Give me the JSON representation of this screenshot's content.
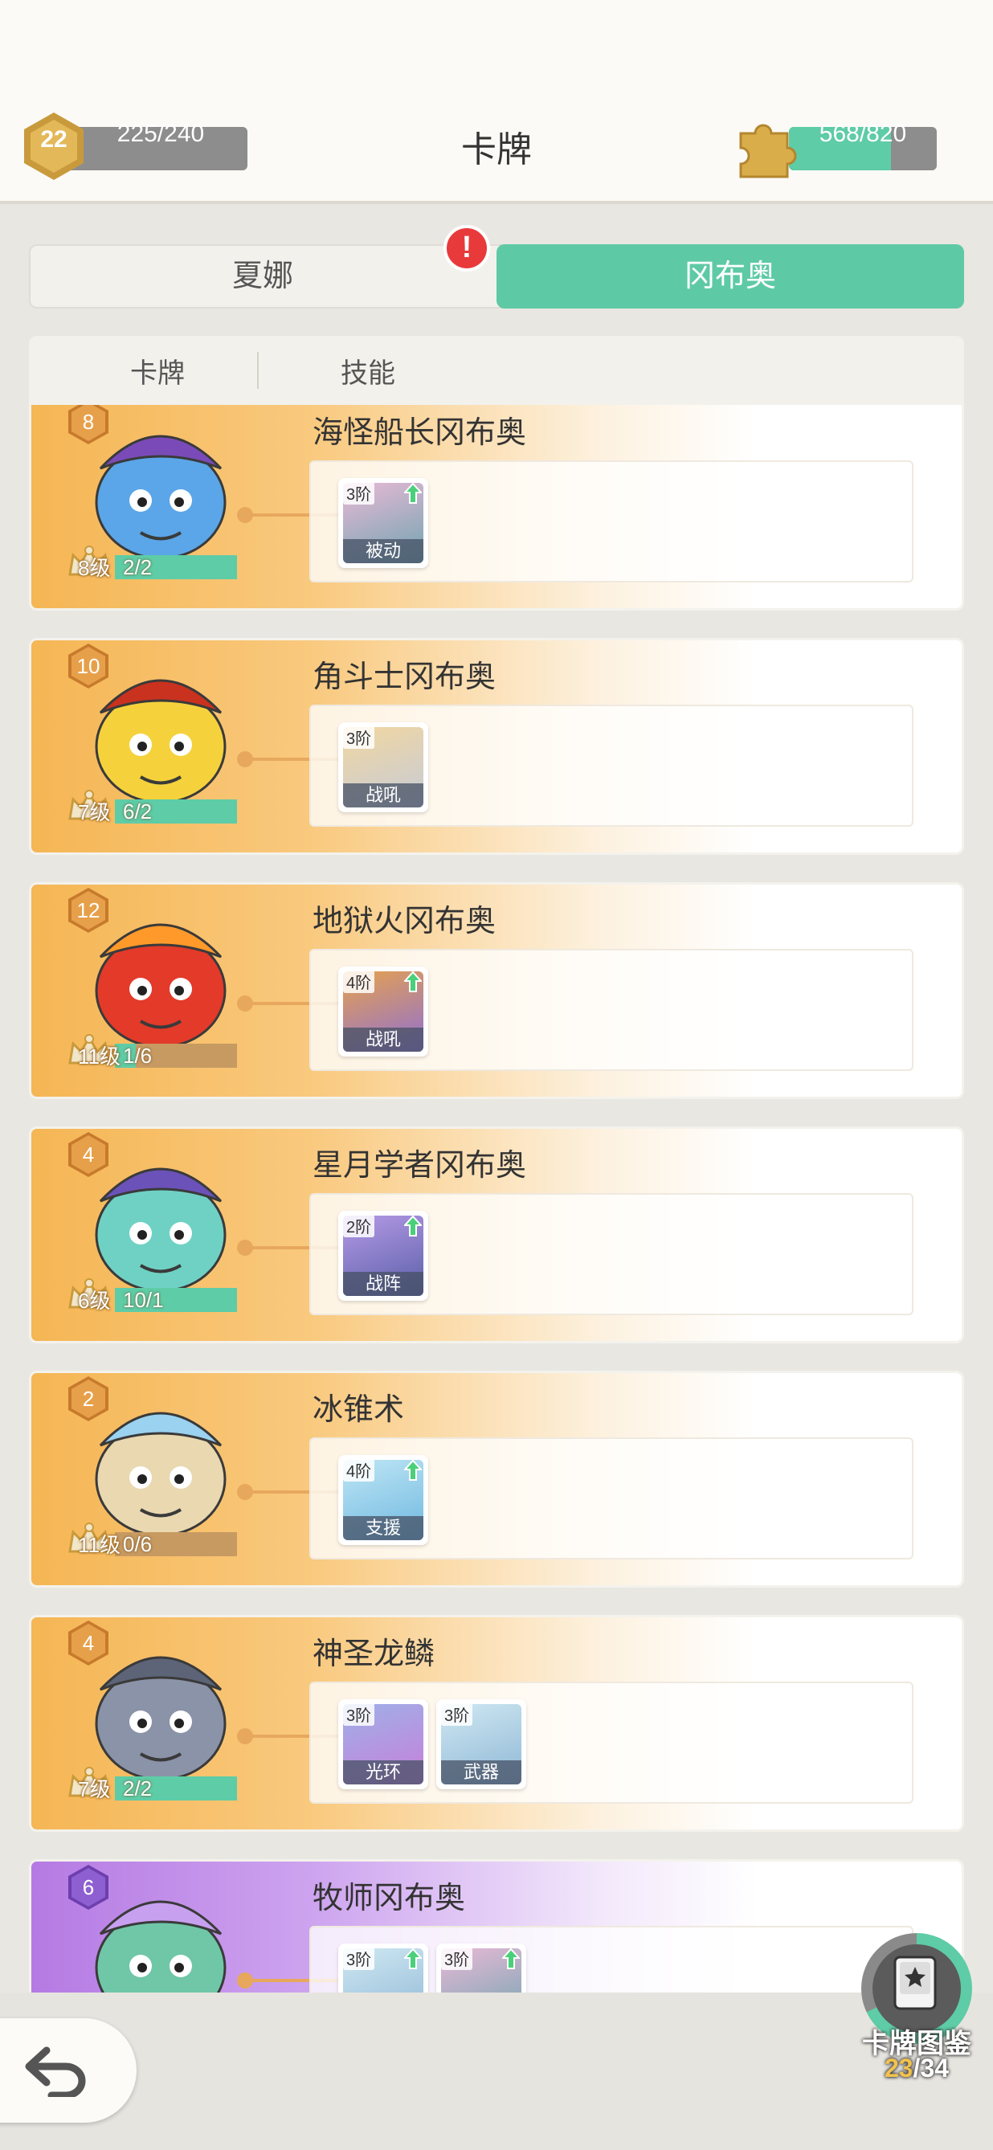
{
  "header": {
    "title": "卡牌",
    "player_level": "22",
    "exp_text": "225/240",
    "puzzle_text": "568/820",
    "puzzle_progress": 0.69
  },
  "hero_tabs": [
    {
      "label": "夏娜",
      "active": false,
      "has_alert": true
    },
    {
      "label": "冈布奥",
      "active": true,
      "has_alert": false
    }
  ],
  "alert_mark": "!",
  "sub_tabs": [
    {
      "label": "卡牌"
    },
    {
      "label": "技能"
    }
  ],
  "cards": [
    {
      "name": "海怪船长冈布奥",
      "cost": "8",
      "level_label": "8级",
      "progress_text": "2/2",
      "progress": 1.0,
      "theme": "orange",
      "skills": [
        {
          "tier": "3阶",
          "name": "被动",
          "upgradable": true
        }
      ]
    },
    {
      "name": "角斗士冈布奥",
      "cost": "10",
      "level_label": "7级",
      "progress_text": "6/2",
      "progress": 1.0,
      "theme": "orange",
      "skills": [
        {
          "tier": "3阶",
          "name": "战吼",
          "upgradable": false
        }
      ]
    },
    {
      "name": "地狱火冈布奥",
      "cost": "12",
      "level_label": "11级",
      "progress_text": "1/6",
      "progress": 0.17,
      "theme": "orange",
      "skills": [
        {
          "tier": "4阶",
          "name": "战吼",
          "upgradable": true
        }
      ]
    },
    {
      "name": "星月学者冈布奥",
      "cost": "4",
      "level_label": "6级",
      "progress_text": "10/1",
      "progress": 1.0,
      "theme": "orange",
      "skills": [
        {
          "tier": "2阶",
          "name": "战阵",
          "upgradable": true
        }
      ]
    },
    {
      "name": "冰锥术",
      "cost": "2",
      "level_label": "11级",
      "progress_text": "0/6",
      "progress": 0.0,
      "theme": "orange",
      "skills": [
        {
          "tier": "4阶",
          "name": "支援",
          "upgradable": true
        }
      ]
    },
    {
      "name": "神圣龙鳞",
      "cost": "4",
      "level_label": "7级",
      "progress_text": "2/2",
      "progress": 1.0,
      "theme": "orange",
      "skills": [
        {
          "tier": "3阶",
          "name": "光环",
          "upgradable": false
        },
        {
          "tier": "3阶",
          "name": "武器",
          "upgradable": false
        }
      ]
    },
    {
      "name": "牧师冈布奥",
      "cost": "6",
      "level_label": "",
      "progress_text": "",
      "progress": 0.0,
      "theme": "purple",
      "skills": [
        {
          "tier": "3阶",
          "name": "",
          "upgradable": true
        },
        {
          "tier": "3阶",
          "name": "",
          "upgradable": true
        }
      ]
    }
  ],
  "deck_button": {
    "label": "卡牌图鉴",
    "count_current": "23",
    "count_separator": "/",
    "count_total": "34",
    "progress": 0.68
  },
  "colors": {
    "accent_green": "#5ecaa5",
    "card_orange": "#f5b654",
    "card_purple": "#b57ae3",
    "alert_red": "#e83a3a"
  },
  "icons": [
    "level-badge-icon",
    "puzzle-icon",
    "alert-icon",
    "crown-icon",
    "upgrade-arrow-icon",
    "back-arrow-icon",
    "card-collection-icon"
  ]
}
